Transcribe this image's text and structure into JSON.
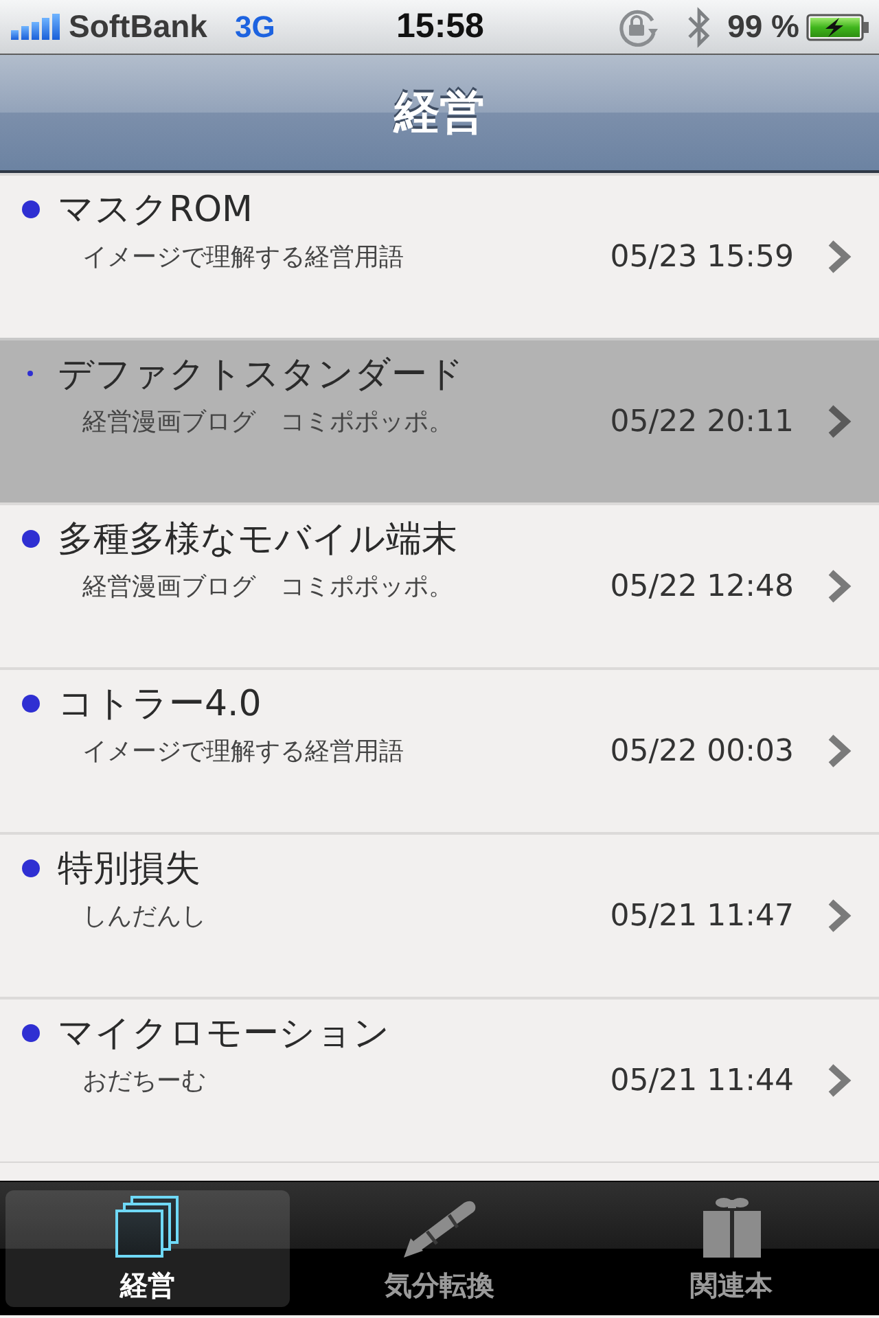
{
  "status_bar": {
    "carrier": "SoftBank",
    "network": "3G",
    "time": "15:58",
    "battery": "99 %"
  },
  "nav_bar": {
    "title": "経営"
  },
  "articles": [
    {
      "title": "マスクROM",
      "source": "イメージで理解する経営用語",
      "date": "05/23 15:59",
      "unread": true,
      "selected": false
    },
    {
      "title": "デファクトスタンダード",
      "source": "経営漫画ブログ　コミポポッポ。",
      "date": "05/22 20:11",
      "unread": false,
      "selected": true
    },
    {
      "title": "多種多様なモバイル端末",
      "source": "経営漫画ブログ　コミポポッポ。",
      "date": "05/22 12:48",
      "unread": true,
      "selected": false
    },
    {
      "title": "コトラー4.0",
      "source": "イメージで理解する経営用語",
      "date": "05/22 00:03",
      "unread": true,
      "selected": false
    },
    {
      "title": "特別損失",
      "source": "しんだんし",
      "date": "05/21 11:47",
      "unread": true,
      "selected": false
    },
    {
      "title": "マイクロモーション",
      "source": "おだちーむ",
      "date": "05/21 11:44",
      "unread": true,
      "selected": false
    }
  ],
  "tab_bar": [
    {
      "label": "経営",
      "selected": true
    },
    {
      "label": "気分転換",
      "selected": false
    },
    {
      "label": "関連本",
      "selected": false
    }
  ]
}
